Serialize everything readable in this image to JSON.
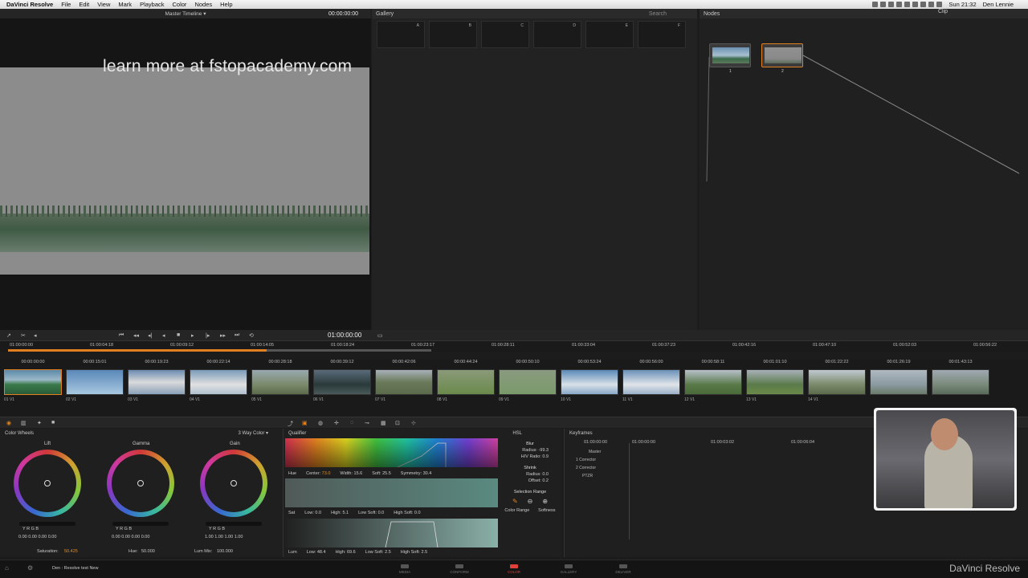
{
  "menubar": {
    "app": "DaVinci Resolve",
    "items": [
      "File",
      "Edit",
      "View",
      "Mark",
      "Playback",
      "Color",
      "Nodes",
      "Help"
    ],
    "clock": "Sun 21:32",
    "user": "Den Lennie"
  },
  "viewer": {
    "title": "Master Timeline ▾",
    "timecode": "00:00:00:00",
    "watermark": "learn more at fstopacademy.com"
  },
  "gallery": {
    "title": "Gallery",
    "search": "Search",
    "stills": [
      "A",
      "B",
      "C",
      "D",
      "E",
      "F"
    ]
  },
  "nodes": {
    "title": "Nodes",
    "clip_label": "Clip",
    "node_labels": [
      "1",
      "2"
    ]
  },
  "transport": {
    "timecode": "01:00:00:00"
  },
  "ruler": {
    "ticks": [
      "01:00:00:00",
      "01:00:04:18",
      "01:00:09:12",
      "01:00:14:05",
      "01:00:18:24",
      "01:00:23:17",
      "01:00:28:11",
      "01:00:33:04",
      "01:00:37:23",
      "01:00:42:16",
      "01:00:47:10",
      "01:00:52:03",
      "01:00:56:22"
    ]
  },
  "clips": [
    {
      "tc": "00:00:00:00",
      "label": "01  V1"
    },
    {
      "tc": "00:00:15:01",
      "label": "02  V1"
    },
    {
      "tc": "00:00:19:23",
      "label": "03  V1"
    },
    {
      "tc": "00:00:22:14",
      "label": "04  V1"
    },
    {
      "tc": "00:00:28:18",
      "label": "05  V1"
    },
    {
      "tc": "00:00:39:12",
      "label": "06  V1"
    },
    {
      "tc": "00:00:42:06",
      "label": "07  V1"
    },
    {
      "tc": "00:00:44:24",
      "label": "08  V1"
    },
    {
      "tc": "00:00:50:10",
      "label": "09  V1"
    },
    {
      "tc": "00:00:53:24",
      "label": "10  V1"
    },
    {
      "tc": "00:00:56:00",
      "label": "11  V1"
    },
    {
      "tc": "00:00:58:11",
      "label": "12  V1"
    },
    {
      "tc": "00:01:01:10",
      "label": "13  V1"
    },
    {
      "tc": "00:01:22:22",
      "label": "14  V1"
    },
    {
      "tc": "00:01:26:19",
      "label": ""
    },
    {
      "tc": "00:01:43:13",
      "label": ""
    }
  ],
  "wheels": {
    "title": "Color Wheels",
    "mode": "3 Way Color ▾",
    "labels": [
      "Lift",
      "Gamma",
      "Gain"
    ],
    "channel_labels": "Y    R    G    B",
    "lift_vals": "0.00  0.00  0.00  0.00",
    "gamma_vals": "0.00  0.00  0.00  0.00",
    "gain_vals": "1.00  1.00  1.00  1.00",
    "saturation_label": "Saturation:",
    "saturation": "50.425",
    "hue_label": "Hue:",
    "hue": "50.000",
    "lummix_label": "Lum Mix:",
    "lummix": "100.000"
  },
  "qualifier": {
    "title": "Qualifier",
    "mode": "HSL",
    "hue_row": {
      "name": "Hue",
      "center_label": "Center:",
      "center": "73.0",
      "width_label": "Width:",
      "width": "15.6",
      "soft_label": "Soft:",
      "soft": "25.5",
      "sym_label": "Symmetry:",
      "sym": "30.4"
    },
    "sat_row": {
      "name": "Sat",
      "low_label": "Low:",
      "low": "0.0",
      "high_label": "High:",
      "high": "5.1",
      "lowsoft_label": "Low Soft:",
      "lowsoft": "0.0",
      "highsoft_label": "High Soft:",
      "highsoft": "0.0"
    },
    "lum_row": {
      "name": "Lum",
      "low_label": "Low:",
      "low": "48.4",
      "high_label": "High:",
      "high": "69.6",
      "lowsoft_label": "Low Soft:",
      "lowsoft": "2.5",
      "highsoft_label": "High Soft:",
      "highsoft": "2.5"
    },
    "blur": {
      "title": "Blur",
      "radius": "Radius:  -99.3",
      "hv": "H/V Ratio:  0.9"
    },
    "shrink": {
      "title": "Shrink",
      "radius": "Radius:  0.0",
      "offset": "Offset:  0.2"
    },
    "sel_range": "Selection Range",
    "color_range": "Color Range",
    "softness": "Softness"
  },
  "keyframes": {
    "title": "Keyframes",
    "ticks": [
      "01:00:00:00",
      "01:00:00:00",
      "01:00:03:02",
      "01:00:06:04"
    ],
    "tracks": [
      "Master",
      "1  Corrector",
      "2  Corrector",
      "PTZR"
    ]
  },
  "status": {
    "project": "Den : Resolve test New",
    "pages": [
      "MEDIA",
      "CONFORM",
      "COLOR",
      "GALLERY",
      "DELIVER"
    ],
    "brand": "DaVinci Resolve"
  }
}
